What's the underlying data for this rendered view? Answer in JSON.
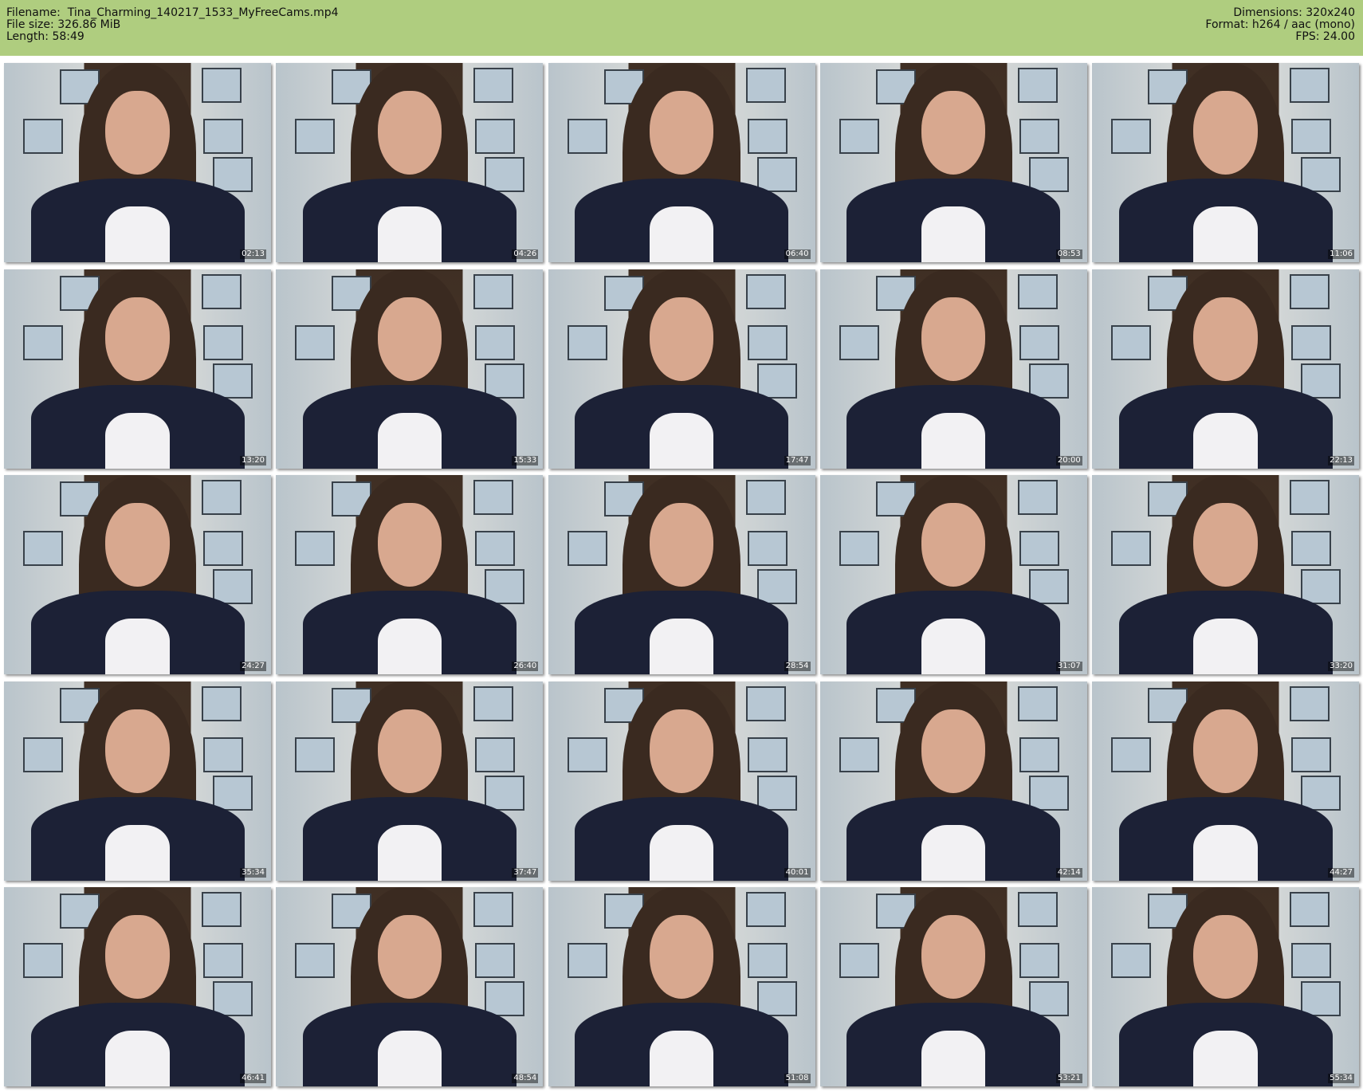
{
  "header": {
    "filename_label": "Filename:",
    "filename": "Tina_Charming_140217_1533_MyFreeCams.mp4",
    "filesize_label": "File size:",
    "filesize": "326.86 MiB",
    "length_label": "Length:",
    "length": "58:49",
    "dimensions_label": "Dimensions:",
    "dimensions": "320x240",
    "format_label": "Format:",
    "format": "h264 / aac (mono)",
    "fps_label": "FPS:",
    "fps": "24.00"
  },
  "colors": {
    "header_bg": "#afcd7f",
    "page_bg": "#ffffff"
  },
  "thumbnails": [
    {
      "timestamp": "02:13"
    },
    {
      "timestamp": "04:26"
    },
    {
      "timestamp": "06:40"
    },
    {
      "timestamp": "08:53"
    },
    {
      "timestamp": "11:06"
    },
    {
      "timestamp": "13:20"
    },
    {
      "timestamp": "15:33"
    },
    {
      "timestamp": "17:47"
    },
    {
      "timestamp": "20:00"
    },
    {
      "timestamp": "22:13"
    },
    {
      "timestamp": "24:27"
    },
    {
      "timestamp": "26:40"
    },
    {
      "timestamp": "28:54"
    },
    {
      "timestamp": "31:07"
    },
    {
      "timestamp": "33:20"
    },
    {
      "timestamp": "35:34"
    },
    {
      "timestamp": "37:47"
    },
    {
      "timestamp": "40:01"
    },
    {
      "timestamp": "42:14"
    },
    {
      "timestamp": "44:27"
    },
    {
      "timestamp": "46:41"
    },
    {
      "timestamp": "48:54"
    },
    {
      "timestamp": "51:08"
    },
    {
      "timestamp": "53:21"
    },
    {
      "timestamp": "55:34"
    }
  ]
}
